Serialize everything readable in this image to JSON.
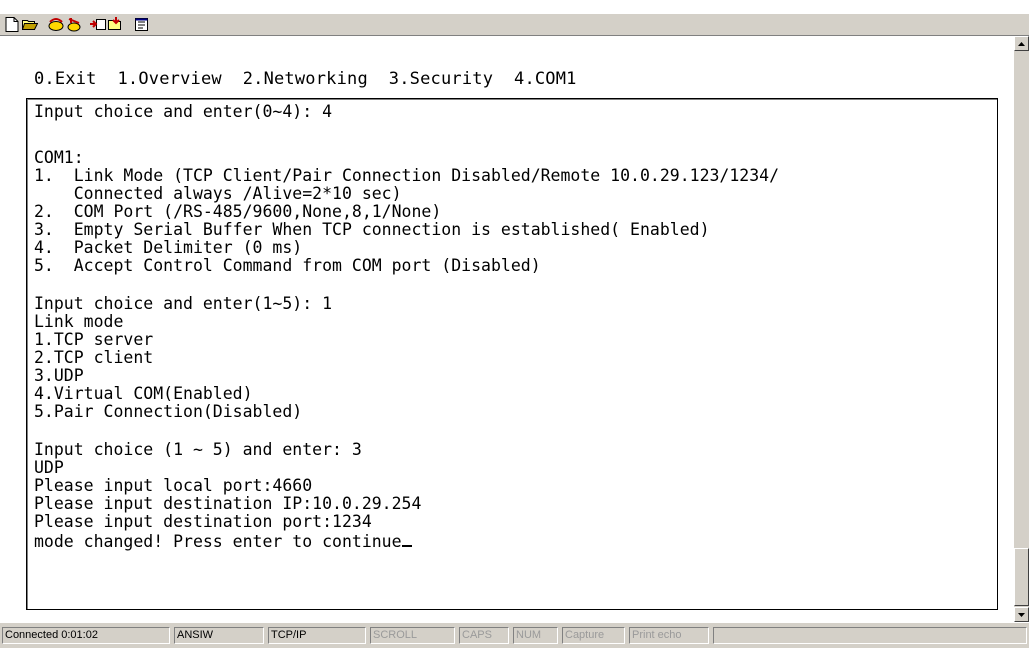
{
  "toolbar": {
    "icons": [
      "new-icon",
      "open-icon",
      "connect-icon",
      "disconnect-icon",
      "send-icon",
      "receive-icon",
      "properties-icon"
    ]
  },
  "menu": "0.Exit  1.Overview  2.Networking  3.Security  4.COM1",
  "terminal": {
    "lines": [
      "Input choice and enter(0~4): 4",
      "",
      "COM1:",
      "1.  Link Mode (TCP Client/Pair Connection Disabled/Remote 10.0.29.123/1234/",
      "    Connected always /Alive=2*10 sec)",
      "2.  COM Port (/RS-485/9600,None,8,1/None)",
      "3.  Empty Serial Buffer When TCP connection is established( Enabled)",
      "4.  Packet Delimiter (0 ms)",
      "5.  Accept Control Command from COM port (Disabled)",
      "",
      "Input choice and enter(1~5): 1",
      "Link mode",
      "1.TCP server",
      "2.TCP client",
      "3.UDP",
      "4.Virtual COM(Enabled)",
      "5.Pair Connection(Disabled)",
      "",
      "Input choice (1 ~ 5) and enter: 3",
      "UDP",
      "Please input local port:4660",
      "Please input destination IP:10.0.29.254",
      "Please input destination port:1234",
      "mode changed! Press enter to continue"
    ]
  },
  "status": {
    "connected": "Connected 0:01:02",
    "emulation": "ANSIW",
    "protocol": "TCP/IP",
    "scroll": "SCROLL",
    "caps": "CAPS",
    "num": "NUM",
    "capture": "Capture",
    "print_echo": "Print echo"
  }
}
